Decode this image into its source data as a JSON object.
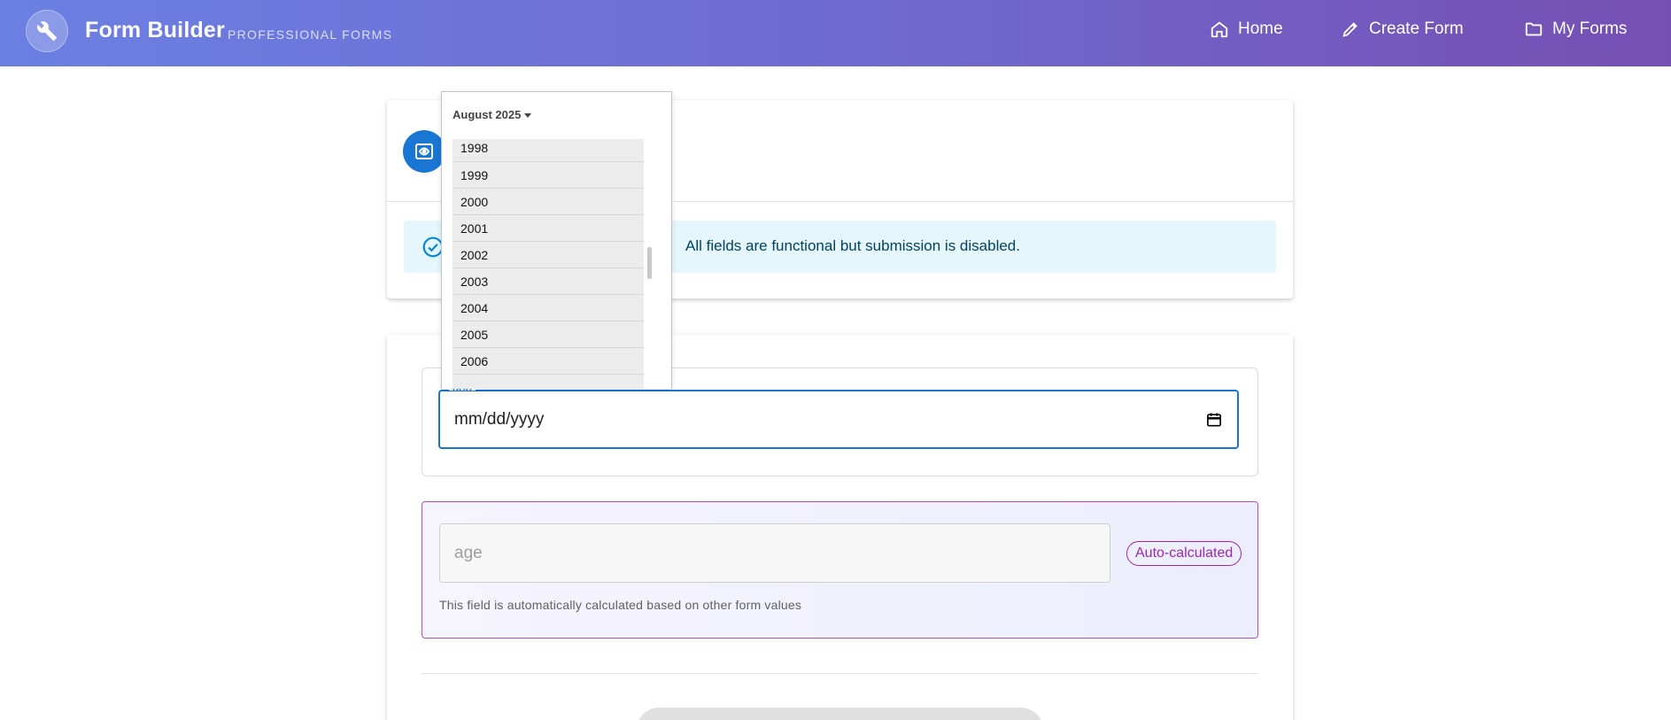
{
  "header": {
    "brand": "Form Builder",
    "brand_sub": "PROFESSIONAL FORMS",
    "logo_icon": "wrench-icon",
    "nav": [
      {
        "label": "Home",
        "icon": "home-icon"
      },
      {
        "label": "Create Form",
        "icon": "pencil-icon"
      },
      {
        "label": "My Forms",
        "icon": "folder-icon"
      }
    ],
    "gradient": [
      "#6b80e2",
      "#764fb3"
    ]
  },
  "preview_card": {
    "avatar_icon": "preview-icon",
    "alert_icon": "check-circle-icon",
    "alert_text_visible": "All fields are functional but submission is disabled."
  },
  "form": {
    "dob": {
      "label": "dob",
      "value": "mm/dd/yyyy",
      "icon": "calendar-icon"
    },
    "age": {
      "placeholder": "age",
      "chip": "Auto-calculated",
      "help": "This field is automatically calculated based on other form values"
    }
  },
  "date_picker": {
    "month_label": "August 2025",
    "years": [
      "1998",
      "1999",
      "2000",
      "2001",
      "2002",
      "2003",
      "2004",
      "2005",
      "2006"
    ]
  },
  "colors": {
    "primary": "#1976d2",
    "alert_bg": "#e5f6fd",
    "accent_purple": "#9c27b0"
  }
}
